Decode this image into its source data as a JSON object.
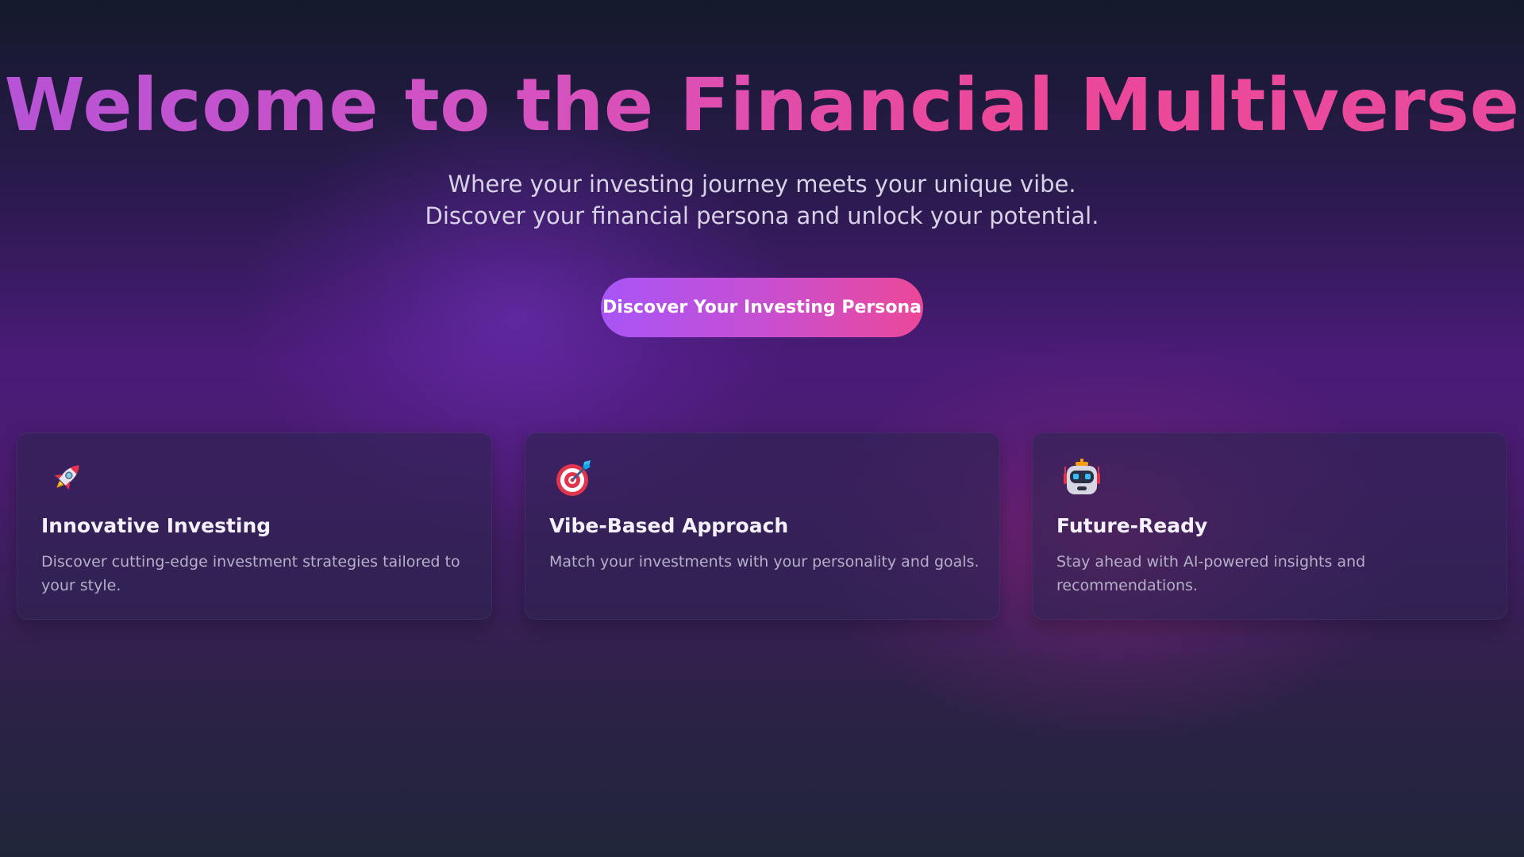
{
  "hero": {
    "title": "Welcome to the Financial Multiverse",
    "subtitle": "Where your investing journey meets your unique vibe. Discover your financial persona and unlock your potential.",
    "cta_label": "Discover Your Investing Persona"
  },
  "features": [
    {
      "icon": "rocket-icon",
      "title": "Innovative Investing",
      "description": "Discover cutting-edge investment strategies tailored to your style."
    },
    {
      "icon": "target-icon",
      "title": "Vibe-Based Approach",
      "description": "Match your investments with your personality and goals."
    },
    {
      "icon": "robot-icon",
      "title": "Future-Ready",
      "description": "Stay ahead with AI-powered insights and recommendations."
    }
  ],
  "colors": {
    "gradient_start": "#a855f7",
    "gradient_end": "#ec4899",
    "background_top": "#141a2b",
    "background_mid": "#4a1b78",
    "card_background": "#2d2350"
  }
}
